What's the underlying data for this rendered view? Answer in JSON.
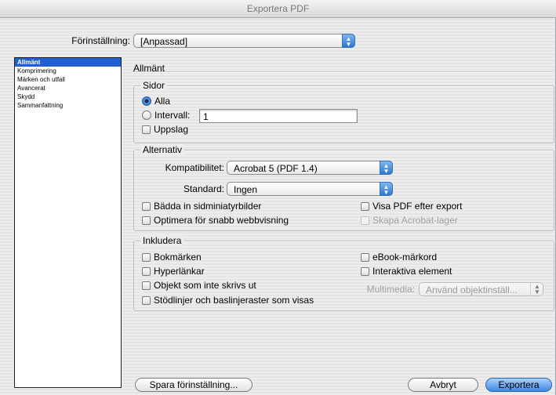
{
  "window": {
    "title": "Exportera PDF"
  },
  "preset": {
    "label": "Förinställning:",
    "value": "[Anpassad]"
  },
  "sidebar": {
    "items": [
      {
        "label": "Allmänt"
      },
      {
        "label": "Komprimering"
      },
      {
        "label": "Märken och utfall"
      },
      {
        "label": "Avancerat"
      },
      {
        "label": "Skydd"
      },
      {
        "label": "Sammanfattning"
      }
    ]
  },
  "section": {
    "title": "Allmänt"
  },
  "pages": {
    "legend": "Sidor",
    "all_label": "Alla",
    "range_label": "Intervall:",
    "range_value": "1",
    "spreads_label": "Uppslag",
    "selected": "all"
  },
  "options": {
    "legend": "Alternativ",
    "compat_label": "Kompatibilitet:",
    "compat_value": "Acrobat 5 (PDF 1.4)",
    "standard_label": "Standard:",
    "standard_value": "Ingen",
    "embed_thumbs": "Bädda in sidminiatyrbilder",
    "optimize_web": "Optimera för snabb webbvisning",
    "view_after": "Visa PDF efter export",
    "acrobat_layers": "Skapa Acrobat-lager"
  },
  "include": {
    "legend": "Inkludera",
    "bookmarks": "Bokmärken",
    "hyperlinks": "Hyperlänkar",
    "nonprinting": "Objekt som inte skrivs ut",
    "guides": "Stödlinjer och baslinjeraster som visas",
    "ebook_tags": "eBook-märkord",
    "interactive": "Interaktiva element",
    "multimedia_label": "Multimedia:",
    "multimedia_value": "Använd objektinställ..."
  },
  "buttons": {
    "save_preset": "Spara förinställning...",
    "cancel": "Avbryt",
    "export": "Exportera"
  }
}
